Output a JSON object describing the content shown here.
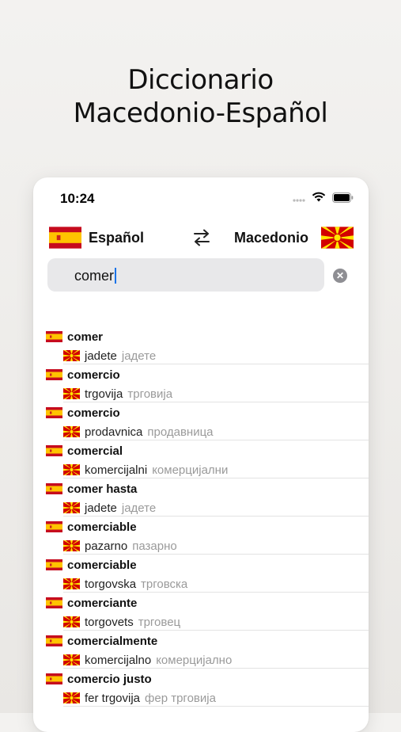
{
  "hero": {
    "line1": "Diccionario",
    "line2": "Macedonio-Español"
  },
  "status": {
    "time": "10:24"
  },
  "language_bar": {
    "source": "Español",
    "target": "Macedonio"
  },
  "search": {
    "value": "comer"
  },
  "results": [
    {
      "es": "comer",
      "mk_latin": "jadete",
      "mk_cyrillic": "јадете"
    },
    {
      "es": "comercio",
      "mk_latin": "trgovija",
      "mk_cyrillic": "трговија"
    },
    {
      "es": "comercio",
      "mk_latin": "prodavnica",
      "mk_cyrillic": "продавница"
    },
    {
      "es": "comercial",
      "mk_latin": "komercijalni",
      "mk_cyrillic": "комерцијални"
    },
    {
      "es": "comer hasta",
      "mk_latin": "jadete",
      "mk_cyrillic": "јадете"
    },
    {
      "es": "comerciable",
      "mk_latin": "pazarno",
      "mk_cyrillic": "пазарно"
    },
    {
      "es": "comerciable",
      "mk_latin": "torgovska",
      "mk_cyrillic": "трговска"
    },
    {
      "es": "comerciante",
      "mk_latin": "torgovets",
      "mk_cyrillic": "трговец"
    },
    {
      "es": "comercialmente",
      "mk_latin": "komercijalno",
      "mk_cyrillic": "комерцијално"
    },
    {
      "es": "comercio justo",
      "mk_latin": "fer trgovija",
      "mk_cyrillic": "фер трговија"
    }
  ],
  "icons": {
    "spain_flag": "spain-flag-icon",
    "macedonia_flag": "macedonia-flag-icon",
    "swap": "swap-arrows-icon",
    "clear": "clear-icon"
  },
  "colors": {
    "spain_red": "#c60b1e",
    "spain_yellow": "#ffc400",
    "macedonia_red": "#d20000",
    "macedonia_yellow": "#ffe600",
    "caret": "#1a73e8"
  }
}
